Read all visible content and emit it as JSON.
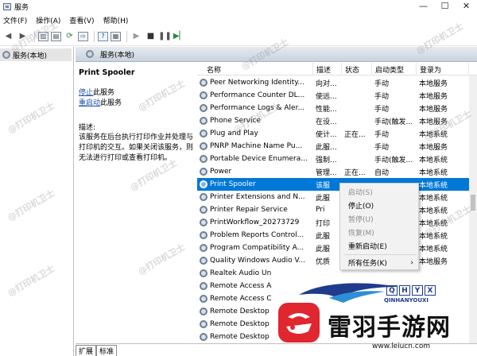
{
  "window": {
    "title": "服务",
    "min": "—",
    "max": "☐",
    "close": "✕"
  },
  "menu": [
    "文件(F)",
    "操作(A)",
    "查看(V)",
    "帮助(H)"
  ],
  "tree": {
    "root": "服务(本地)"
  },
  "header": {
    "title": "服务(本地)"
  },
  "details": {
    "name": "Print Spooler",
    "stop_link": "停止",
    "stop_rest": "此服务",
    "restart_link": "重启动",
    "restart_rest": "此服务",
    "desc_label": "描述:",
    "desc_text": "该服务在后台执行打印作业并处理与打印机的交互。如果关闭该服务，则无法进行打印或查看打印机。"
  },
  "columns": [
    "名称",
    "描述",
    "状态",
    "启动类型",
    "登录为"
  ],
  "rows": [
    {
      "name": "Peer Networking Identity...",
      "desc": "向对...",
      "status": "",
      "start": "手动",
      "logon": "本地服务"
    },
    {
      "name": "Performance Counter DL...",
      "desc": "使远...",
      "status": "",
      "start": "手动",
      "logon": "本地服务"
    },
    {
      "name": "Performance Logs & Aler...",
      "desc": "性能...",
      "status": "",
      "start": "手动",
      "logon": "本地服务"
    },
    {
      "name": "Phone Service",
      "desc": "在设...",
      "status": "",
      "start": "手动(触发...",
      "logon": "本地服务"
    },
    {
      "name": "Plug and Play",
      "desc": "使计...",
      "status": "正在...",
      "start": "手动",
      "logon": "本地系统"
    },
    {
      "name": "PNRP Machine Name Pu...",
      "desc": "此服...",
      "status": "",
      "start": "手动",
      "logon": "本地服务"
    },
    {
      "name": "Portable Device Enumera...",
      "desc": "强制...",
      "status": "",
      "start": "手动(触发...",
      "logon": "本地系统"
    },
    {
      "name": "Power",
      "desc": "管理...",
      "status": "正在...",
      "start": "自动",
      "logon": "本地系统"
    },
    {
      "name": "Print Spooler",
      "desc": "该服",
      "status": "",
      "start": "",
      "logon": "本地系统"
    },
    {
      "name": "Printer Extensions and N...",
      "desc": "此服",
      "status": "",
      "start": "",
      "logon": "本地系统"
    },
    {
      "name": "Printer Repair Service",
      "desc": "Pri",
      "status": "",
      "start": "",
      "logon": "本地系统"
    },
    {
      "name": "PrintWorkflow_20273729",
      "desc": "打印",
      "status": "",
      "start": "",
      "logon": "本地系统"
    },
    {
      "name": "Problem Reports Control...",
      "desc": "此服",
      "status": "",
      "start": "",
      "logon": "本地系统"
    },
    {
      "name": "Program Compatibility A...",
      "desc": "此服",
      "status": "",
      "start": "",
      "logon": "本地系统"
    },
    {
      "name": "Quality Windows Audio V...",
      "desc": "优质",
      "status": "",
      "start": "",
      "logon": "本地服务"
    },
    {
      "name": "Realtek Audio Un",
      "desc": "",
      "status": "",
      "start": "",
      "logon": ""
    },
    {
      "name": "Remote Access A",
      "desc": "",
      "status": "",
      "start": "",
      "logon": ""
    },
    {
      "name": "Remote Access C",
      "desc": "",
      "status": "",
      "start": "",
      "logon": ""
    },
    {
      "name": "Remote Desktop",
      "desc": "",
      "status": "",
      "start": "",
      "logon": ""
    },
    {
      "name": "Remote Desktop",
      "desc": "",
      "status": "",
      "start": "",
      "logon": ""
    },
    {
      "name": "Remote Desktop",
      "desc": "",
      "status": "",
      "start": "",
      "logon": ""
    }
  ],
  "context_menu": {
    "items": [
      {
        "label": "启动(S)",
        "enabled": false
      },
      {
        "label": "停止(O)",
        "enabled": true
      },
      {
        "label": "暂停(U)",
        "enabled": false
      },
      {
        "label": "恢复(M)",
        "enabled": false
      },
      {
        "label": "重新启动(E)",
        "enabled": true
      },
      {
        "label": "所有任务(K)",
        "enabled": true,
        "arrow": "›"
      }
    ]
  },
  "tabs": [
    "扩展",
    "标准"
  ],
  "watermark": {
    "text": "@打印机卫士"
  },
  "overlay": {
    "letters": [
      "Q",
      "H",
      "Y",
      "X"
    ],
    "sub": "QINHANYOUXI",
    "brand": "雷羽手游网",
    "site": "www.leiucn.com"
  },
  "colors": {
    "selection": "#0078d7",
    "link": "#1a4fa8",
    "brand_red": "#e0262f",
    "brand_blue": "#1f3b8c"
  }
}
